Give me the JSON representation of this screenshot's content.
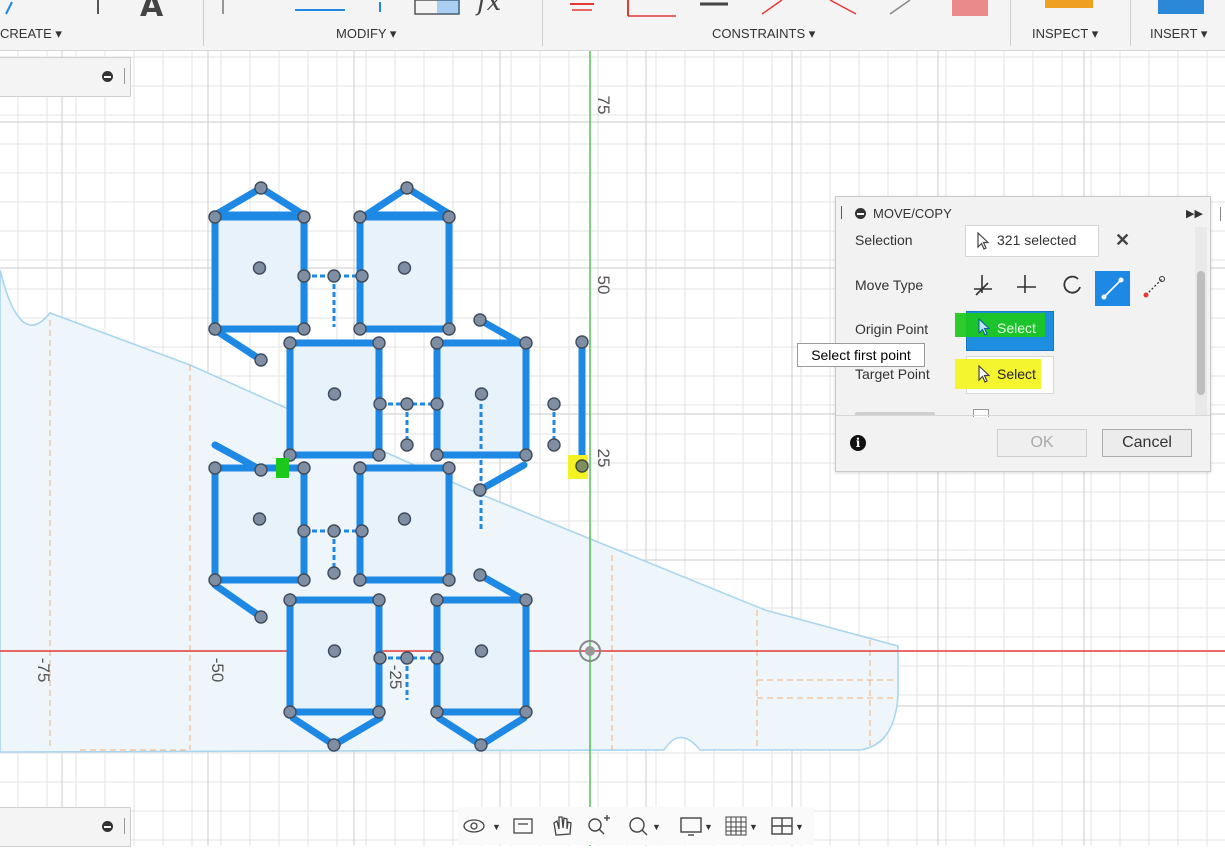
{
  "toolbar": {
    "groups": [
      "CREATE ▾",
      "MODIFY ▾",
      "CONSTRAINTS ▾",
      "INSPECT ▾",
      "INSERT ▾"
    ]
  },
  "canvas": {
    "axis_labels": [
      "75",
      "50",
      "25",
      "-75",
      "-50",
      "-25"
    ],
    "colors": {
      "sketch": "#1e88e5",
      "x_axis": "#e53935",
      "y_axis": "#43c043",
      "grid": "#e3e3e3",
      "body_outline": "#a9d6ee"
    }
  },
  "dialog": {
    "title": "MOVE/COPY",
    "selection_label": "Selection",
    "selection_value": "321 selected",
    "move_type_label": "Move Type",
    "origin_label": "Origin Point",
    "origin_button": "Select",
    "target_label": "Target Point",
    "target_button": "Select",
    "ok": "OK",
    "cancel": "Cancel"
  },
  "tooltip": "Select first point",
  "navbar": {
    "icons": [
      "orbit-icon",
      "look-at-icon",
      "pan-icon",
      "zoom-icon",
      "fit-icon",
      "display-settings-icon",
      "grid-settings-icon",
      "viewports-icon"
    ]
  }
}
